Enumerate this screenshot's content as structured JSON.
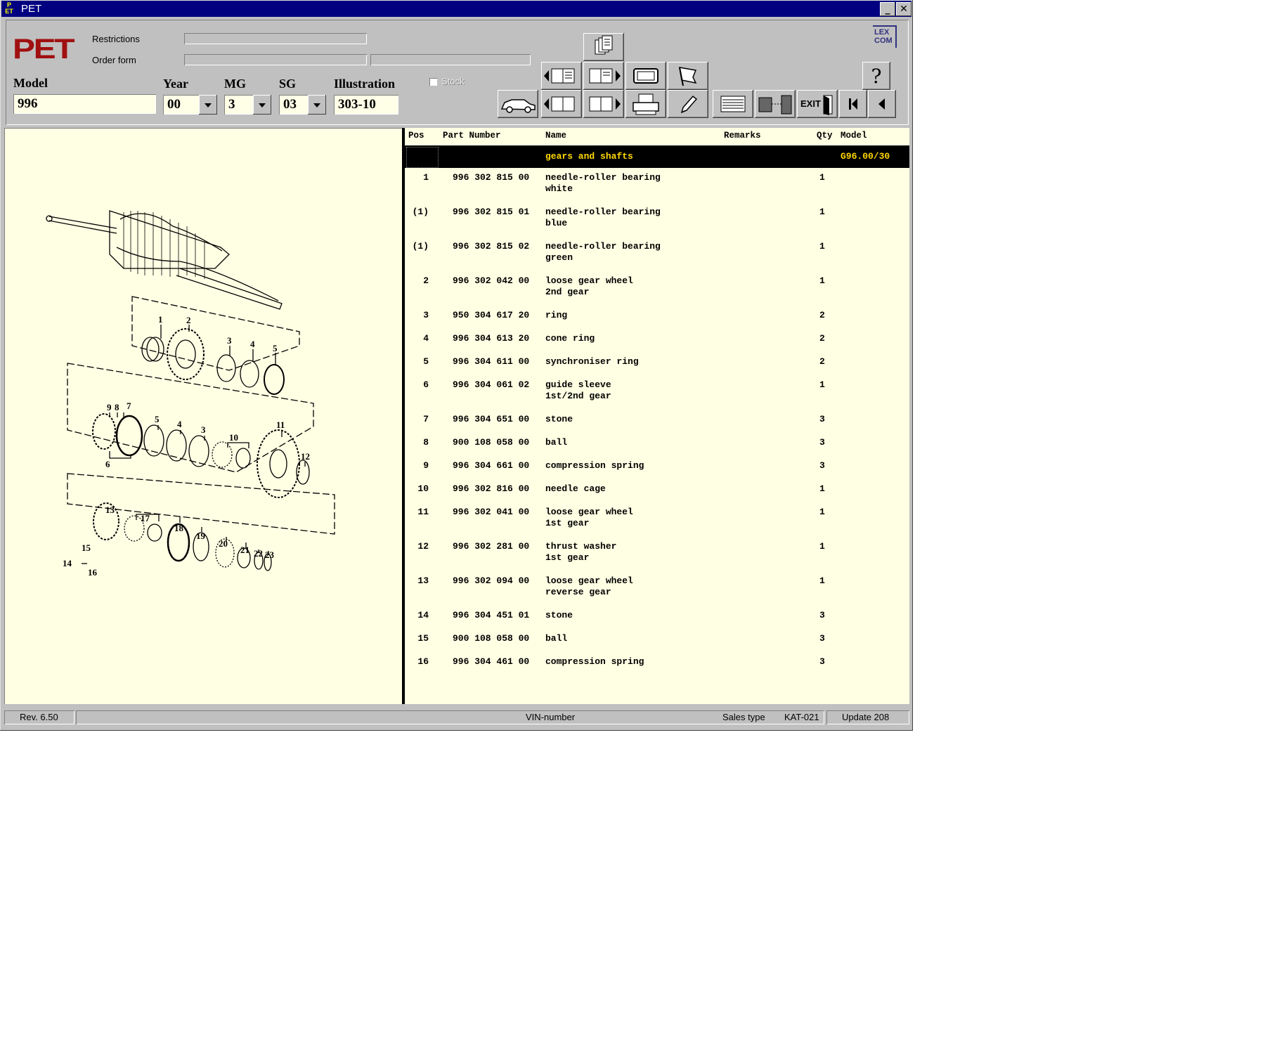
{
  "window": {
    "title": "PET",
    "app_icon_text": "PET"
  },
  "header": {
    "logo": "PET",
    "restrictions_label": "Restrictions",
    "order_form_label": "Order form",
    "stock_label": "Stock",
    "model_label": "Model",
    "model_value": "996",
    "year_label": "Year",
    "year_value": "00",
    "mg_label": "MG",
    "mg_value": "3",
    "sg_label": "SG",
    "sg_value": "03",
    "illustration_label": "Illustration",
    "illustration_value": "303-10",
    "lexcom": "LEX COM",
    "exit_label": "EXIT"
  },
  "table": {
    "columns": [
      "Pos",
      "Part Number",
      "Name",
      "Remarks",
      "Qty",
      "Model"
    ],
    "group": {
      "name": "gears and shafts",
      "model": "G96.00/30"
    },
    "rows": [
      {
        "pos": "1",
        "part": "996 302 815 00",
        "name": "needle-roller bearing",
        "name2": "white",
        "qty": "1"
      },
      {
        "pos": "(1)",
        "part": "996 302 815 01",
        "name": "needle-roller bearing",
        "name2": "blue",
        "qty": "1"
      },
      {
        "pos": "(1)",
        "part": "996 302 815 02",
        "name": "needle-roller bearing",
        "name2": "green",
        "qty": "1"
      },
      {
        "pos": "2",
        "part": "996 302 042 00",
        "name": "loose gear wheel",
        "name2": "2nd gear",
        "qty": "1"
      },
      {
        "pos": "3",
        "part": "950 304 617 20",
        "name": "ring",
        "name2": "",
        "qty": "2"
      },
      {
        "pos": "4",
        "part": "996 304 613 20",
        "name": "cone ring",
        "name2": "",
        "qty": "2"
      },
      {
        "pos": "5",
        "part": "996 304 611 00",
        "name": "synchroniser ring",
        "name2": "",
        "qty": "2"
      },
      {
        "pos": "6",
        "part": "996 304 061 02",
        "name": "guide sleeve",
        "name2": "1st/2nd gear",
        "qty": "1"
      },
      {
        "pos": "7",
        "part": "996 304 651 00",
        "name": "stone",
        "name2": "",
        "qty": "3"
      },
      {
        "pos": "8",
        "part": "900 108 058 00",
        "name": "ball",
        "name2": "",
        "qty": "3"
      },
      {
        "pos": "9",
        "part": "996 304 661 00",
        "name": "compression spring",
        "name2": "",
        "qty": "3"
      },
      {
        "pos": "10",
        "part": "996 302 816 00",
        "name": "needle cage",
        "name2": "",
        "qty": "1"
      },
      {
        "pos": "11",
        "part": "996 302 041 00",
        "name": "loose gear wheel",
        "name2": "1st gear",
        "qty": "1"
      },
      {
        "pos": "12",
        "part": "996 302 281 00",
        "name": "thrust washer",
        "name2": "1st gear",
        "qty": "1"
      },
      {
        "pos": "13",
        "part": "996 302 094 00",
        "name": "loose gear wheel",
        "name2": "reverse gear",
        "qty": "1"
      },
      {
        "pos": "14",
        "part": "996 304 451 01",
        "name": "stone",
        "name2": "",
        "qty": "3"
      },
      {
        "pos": "15",
        "part": "900 108 058 00",
        "name": "ball",
        "name2": "",
        "qty": "3"
      },
      {
        "pos": "16",
        "part": "996 304 461 00",
        "name": "compression spring",
        "name2": "",
        "qty": "3"
      }
    ]
  },
  "illustration_callouts": [
    "1",
    "2",
    "3",
    "4",
    "5",
    "9",
    "8",
    "7",
    "5",
    "4",
    "3",
    "10",
    "11",
    "12",
    "6",
    "13",
    "17",
    "18",
    "19",
    "20",
    "21",
    "22",
    "23",
    "15",
    "14",
    "16"
  ],
  "status": {
    "rev": "Rev. 6.50",
    "vin": "VIN-number",
    "sales_type": "Sales type",
    "kat": "KAT-021",
    "update": "Update 208"
  },
  "icons": [
    "car-icon",
    "prev-page-icon",
    "next-page-icon",
    "print-icon",
    "pencil-icon",
    "flag-icon",
    "window-icon",
    "list-icon",
    "calculator-icon",
    "help-icon",
    "first-icon",
    "back-icon",
    "exit-icon"
  ]
}
